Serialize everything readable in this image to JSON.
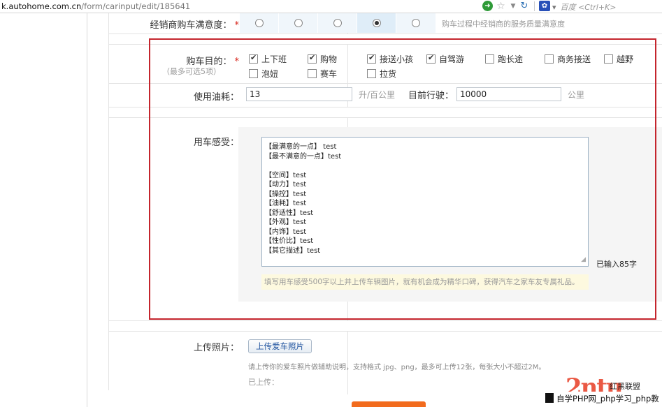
{
  "browser": {
    "url_domain": "k.autohome.com.cn",
    "url_path": "/form/carinput/edit/185641",
    "search_engine_hint": "百度 <Ctrl+K>"
  },
  "form": {
    "satisfaction": {
      "label": "经销商购车满意度：",
      "required_mark": "*",
      "options_count": 5,
      "selected_index": 3,
      "hint": "购车过程中经销商的服务质量满意度"
    },
    "purpose": {
      "label": "购车目的：",
      "required_mark": "*",
      "sublabel": "（最多可选5项）",
      "options": [
        {
          "label": "上下班",
          "checked": true
        },
        {
          "label": "购物",
          "checked": true
        },
        {
          "label": "接送小孩",
          "checked": true
        },
        {
          "label": "自驾游",
          "checked": true
        },
        {
          "label": "跑长途",
          "checked": false
        },
        {
          "label": "商务接送",
          "checked": false
        },
        {
          "label": "越野",
          "checked": false
        },
        {
          "label": "泡妞",
          "checked": false
        },
        {
          "label": "赛车",
          "checked": false
        },
        {
          "label": "拉货",
          "checked": false
        }
      ]
    },
    "fuel": {
      "label": "使用油耗：",
      "value": "13",
      "unit": "升/百公里",
      "mileage_label": "目前行驶：",
      "mileage_value": "10000",
      "mileage_unit": "公里"
    },
    "feeling": {
      "label": "用车感受：",
      "lines": [
        "【最满意的一点】 test",
        "【最不满意的一点】test",
        "",
        "【空间】test",
        "【动力】test",
        "【操控】test",
        "【油耗】test",
        "【舒适性】test",
        "【外观】test",
        "【内饰】test",
        "【性价比】test",
        "【其它描述】test"
      ],
      "count_text": "已输入85字",
      "tip": "填写用车感受500字以上并上传车辆图片，就有机会成为精华口碑，获得汽车之家车友专属礼品。"
    },
    "photo": {
      "label": "上传照片：",
      "button": "上传爱车照片",
      "help": "请上传你的爱车照片做辅助说明，支持格式 jpg、png，最多可上传12张，每张大小不超过2M。",
      "uploaded": "已上传："
    }
  },
  "watermark": {
    "brand": "红黑联盟",
    "text": "自学PHP网_php学习_php教"
  },
  "icons": {
    "go": "go-icon",
    "star": "bookmark-star-icon",
    "reload": "reload-icon",
    "search_engine": "paw-icon"
  }
}
